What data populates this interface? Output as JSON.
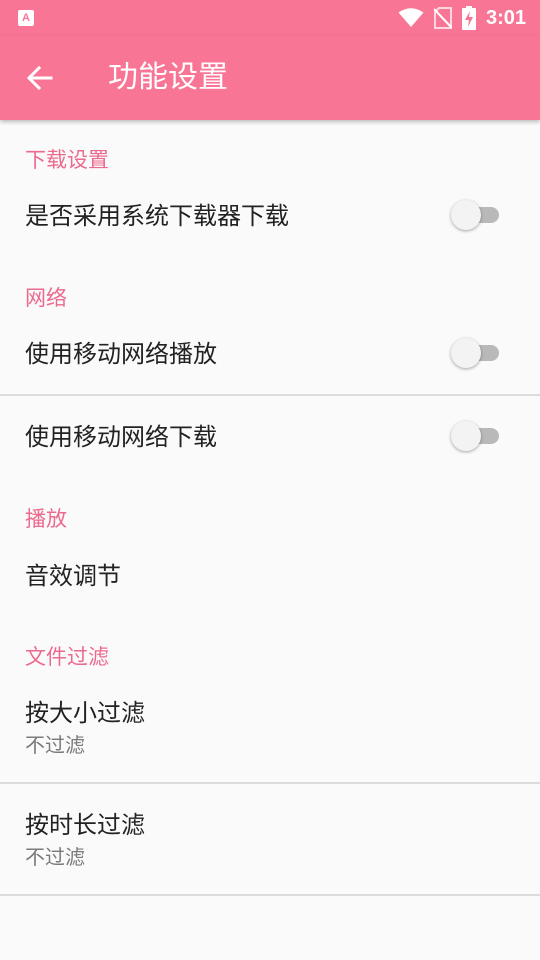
{
  "status_bar": {
    "app_icon_letter": "A",
    "time": "3:01"
  },
  "app_bar": {
    "title": "功能设置"
  },
  "sections": {
    "download": {
      "header": "下载设置",
      "system_downloader": {
        "title": "是否采用系统下载器下载",
        "enabled": false
      }
    },
    "network": {
      "header": "网络",
      "mobile_play": {
        "title": "使用移动网络播放",
        "enabled": false
      },
      "mobile_download": {
        "title": "使用移动网络下载",
        "enabled": false
      }
    },
    "playback": {
      "header": "播放",
      "sound_effect": {
        "title": "音效调节"
      }
    },
    "file_filter": {
      "header": "文件过滤",
      "by_size": {
        "title": "按大小过滤",
        "summary": "不过滤"
      },
      "by_duration": {
        "title": "按时长过滤",
        "summary": "不过滤"
      }
    }
  }
}
